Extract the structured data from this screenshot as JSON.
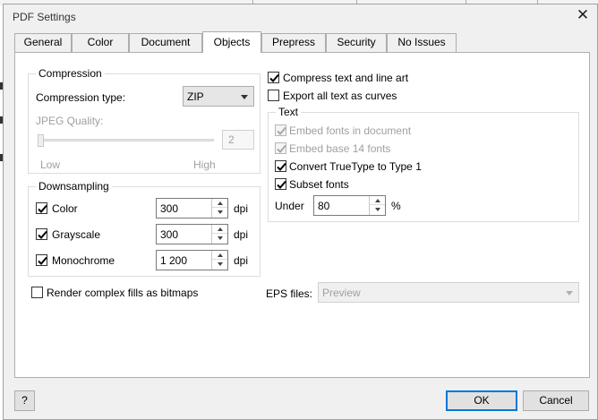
{
  "window": {
    "title": "PDF Settings"
  },
  "tabs": [
    {
      "label": "General"
    },
    {
      "label": "Color"
    },
    {
      "label": "Document"
    },
    {
      "label": "Objects",
      "active": true
    },
    {
      "label": "Prepress"
    },
    {
      "label": "Security"
    },
    {
      "label": "No Issues"
    }
  ],
  "compression": {
    "title": "Compression",
    "type_label": "Compression type:",
    "type_value": "ZIP",
    "jpeg_label": "JPEG Quality:",
    "jpeg_value": "2",
    "low_label": "Low",
    "high_label": "High"
  },
  "downsampling": {
    "title": "Downsampling",
    "unit": "dpi",
    "rows": [
      {
        "label": "Color",
        "value": "300",
        "checked": true
      },
      {
        "label": "Grayscale",
        "value": "300",
        "checked": true
      },
      {
        "label": "Monochrome",
        "value": "1 200",
        "checked": true
      }
    ]
  },
  "options": {
    "compress_text": "Compress text and line art",
    "compress_text_checked": true,
    "export_text_curves": "Export all text as curves",
    "export_text_curves_checked": false
  },
  "text_group": {
    "title": "Text",
    "embed_fonts": "Embed fonts in document",
    "embed_base14": "Embed base 14 fonts",
    "convert_truetype": "Convert TrueType to Type 1",
    "subset_fonts": "Subset fonts",
    "under_label": "Under",
    "under_value": "80",
    "percent": "%"
  },
  "render_complex": {
    "label": "Render complex fills as bitmaps",
    "checked": false
  },
  "eps": {
    "label": "EPS files:",
    "value": "Preview"
  },
  "buttons": {
    "help": "?",
    "ok": "OK",
    "cancel": "Cancel"
  }
}
